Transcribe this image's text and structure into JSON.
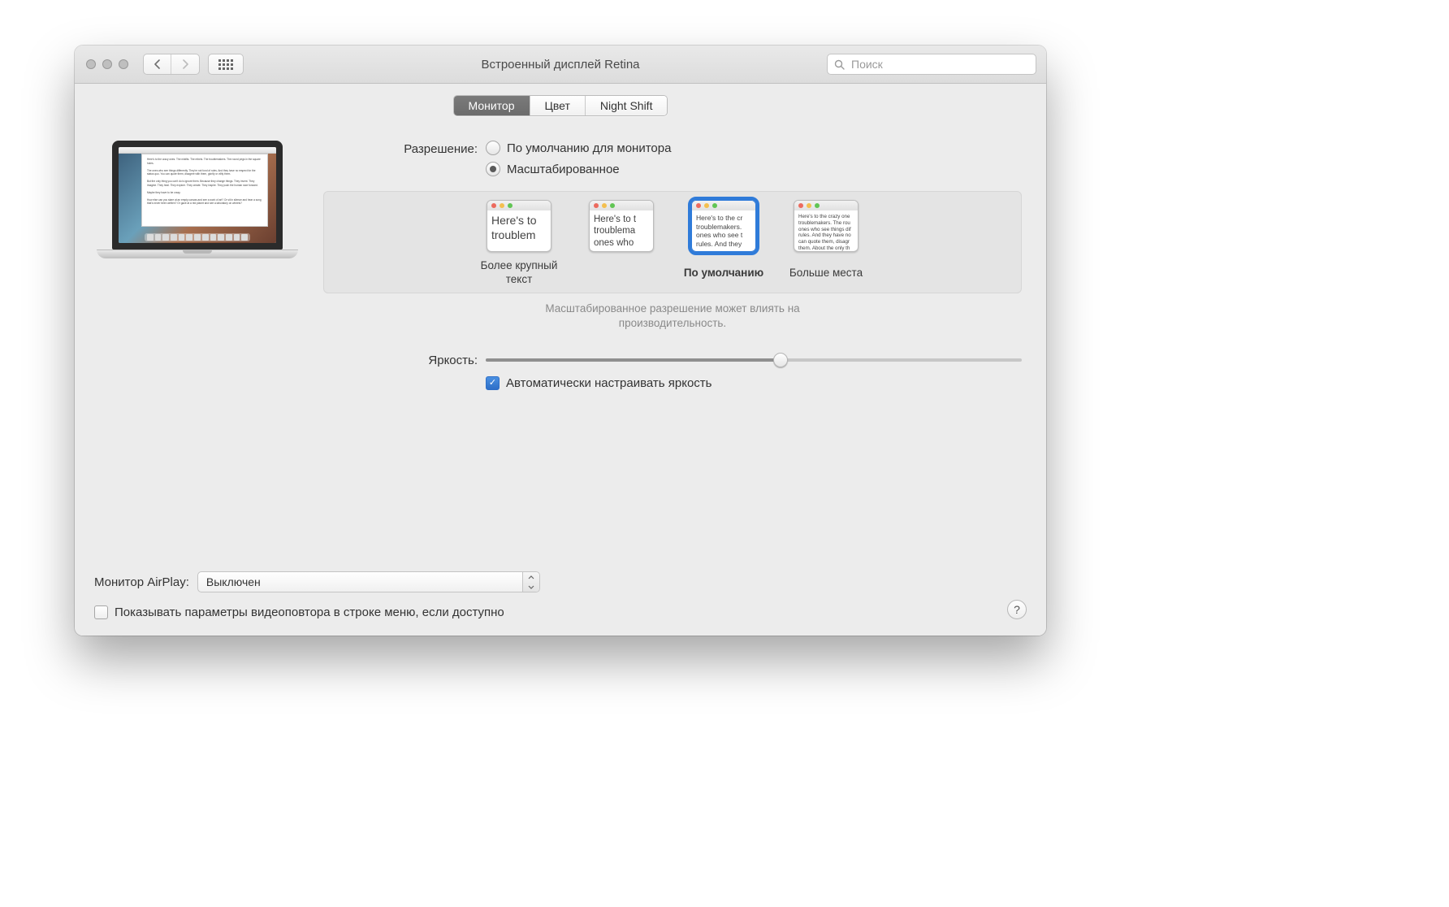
{
  "window": {
    "title": "Встроенный дисплей Retina"
  },
  "search": {
    "placeholder": "Поиск"
  },
  "tabs": {
    "monitor": "Монитор",
    "color": "Цвет",
    "night_shift": "Night Shift"
  },
  "resolution": {
    "label": "Разрешение:",
    "default_for_monitor": "По умолчанию для монитора",
    "scaled": "Масштабированное",
    "options": {
      "larger_text": "Более крупный текст",
      "blank": "",
      "default": "По умолчанию",
      "more_space": "Больше места"
    },
    "performance_note_l1": "Масштабированное разрешение может влиять на",
    "performance_note_l2": "производительность.",
    "thumb_text_large": "Here's to\ntroublem",
    "thumb_text_med": "Here's to t\ntroublema\nones who",
    "thumb_text_default": "Here's to the cr\ntroublemakers.\nones who see t\nrules. And they",
    "thumb_text_small": "Here's to the crazy one\ntroublemakers. The rou\nones who see things dif\nrules. And they have no\ncan quote them, disagr\nthem. About the only th\nBecause they change th"
  },
  "brightness": {
    "label": "Яркость:",
    "value_percent": 55,
    "auto_label": "Автоматически настраивать яркость",
    "auto_checked": true
  },
  "airplay": {
    "label": "Монитор AirPlay:",
    "value": "Выключен"
  },
  "mirroring": {
    "label": "Показывать параметры видеоповтора в строке меню, если доступно",
    "checked": false
  },
  "help": {
    "label": "?"
  }
}
